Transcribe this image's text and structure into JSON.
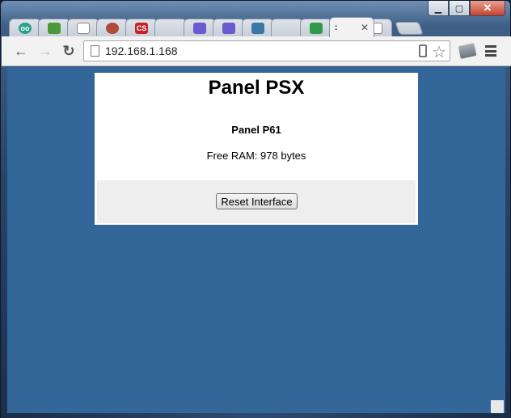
{
  "browser": {
    "url": "192.168.1.168",
    "active_tab_label": ":",
    "tabs": [
      {
        "icon": "tripadvisor-icon",
        "color": "#2aa08a",
        "glyph": "oo"
      },
      {
        "icon": "sdf-icon",
        "color": "#4a9a3a",
        "glyph": "SDF"
      },
      {
        "icon": "page-icon",
        "color": "#888888",
        "glyph": ""
      },
      {
        "icon": "js-icon",
        "color": "#b04a3a",
        "glyph": "JL"
      },
      {
        "icon": "cs-icon",
        "color": "#c8202a",
        "glyph": "CS"
      },
      {
        "icon": "blank-icon",
        "color": "#999999",
        "glyph": ""
      },
      {
        "icon": "wave-icon",
        "color": "#6a5ad0",
        "glyph": "~"
      },
      {
        "icon": "wave-icon",
        "color": "#6a5ad0",
        "glyph": "~"
      },
      {
        "icon": "shield-icon",
        "color": "#3a78a8",
        "glyph": "U"
      },
      {
        "icon": "blank-icon",
        "color": "#999999",
        "glyph": ""
      },
      {
        "icon": "drive-icon",
        "color": "#2f9a4a",
        "glyph": "▲"
      },
      {
        "icon": "page-icon",
        "color": "#888888",
        "glyph": ""
      }
    ]
  },
  "page": {
    "title": "Panel PSX",
    "subtitle": "Panel P61",
    "free_ram": "Free RAM: 978 bytes",
    "reset_button_label": "Reset Interface"
  },
  "colors": {
    "background": "#336699",
    "panel": "#ffffff",
    "form_area": "#eeeeee"
  }
}
